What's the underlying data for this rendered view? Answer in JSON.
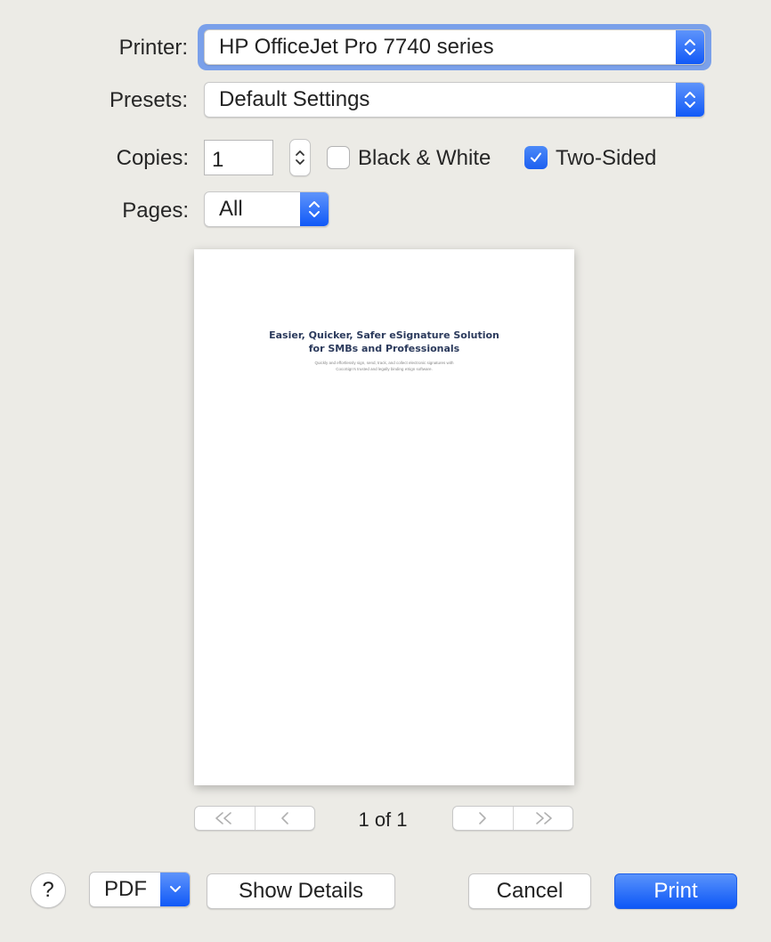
{
  "printer": {
    "label": "Printer:",
    "value": "HP OfficeJet Pro 7740 series"
  },
  "presets": {
    "label": "Presets:",
    "value": "Default Settings"
  },
  "copies": {
    "label": "Copies:",
    "value": "1"
  },
  "black_white": {
    "label": "Black & White",
    "checked": false
  },
  "two_sided": {
    "label": "Two-Sided",
    "checked": true
  },
  "pages": {
    "label": "Pages:",
    "value": "All"
  },
  "preview": {
    "title_line1": "Easier, Quicker, Safer eSignature Solution",
    "title_line2": "for SMBs and Professionals",
    "subtitle_line1": "Quickly and effortlessly sign, send, track, and collect electronic signatures with",
    "subtitle_line2": "CocoSign's trusted and legally binding eSign software."
  },
  "pagination": {
    "first_icon": "«",
    "prev_icon": "‹",
    "next_icon": "›",
    "last_icon": "»",
    "page_text": "1 of 1"
  },
  "footer": {
    "help_label": "?",
    "pdf_label": "PDF",
    "show_details_label": "Show Details",
    "cancel_label": "Cancel",
    "print_label": "Print"
  },
  "colors": {
    "accent": "#1d5ff0",
    "focus_ring": "#7aa0ea",
    "background": "#ecebe6"
  }
}
